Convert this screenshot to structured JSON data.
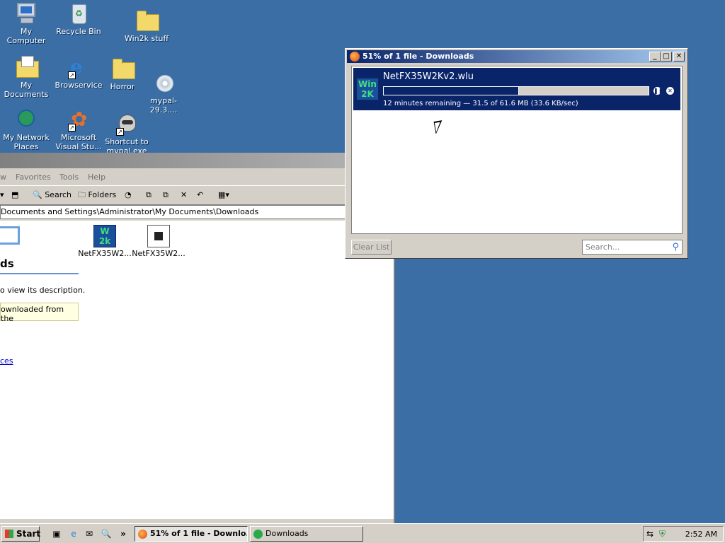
{
  "desktop": {
    "icons": [
      {
        "label": "My Computer"
      },
      {
        "label": "Recycle Bin"
      },
      {
        "label": "Win2k stuff"
      },
      {
        "label": "My Documents"
      },
      {
        "label": "Browservice"
      },
      {
        "label": "Horror"
      },
      {
        "label": "mypal-29.3...."
      },
      {
        "label": "My Network Places"
      },
      {
        "label": "Microsoft Visual Stu..."
      },
      {
        "label": "Shortcut to mypal.exe"
      }
    ]
  },
  "explorer": {
    "menu": [
      "w",
      "Favorites",
      "Tools",
      "Help"
    ],
    "toolbar": {
      "search_label": "Search",
      "folders_label": "Folders"
    },
    "address": "Documents and Settings\\Administrator\\My Documents\\Downloads",
    "heading": "ds",
    "hint": "o view its description.",
    "tip": "ownloaded from the",
    "link": "ces",
    "files": [
      {
        "label": "NetFX35W2..."
      },
      {
        "label": "NetFX35W2..."
      }
    ]
  },
  "downloads_window": {
    "title": "51% of 1 file - Downloads",
    "item": {
      "filename": "NetFX35W2Kv2.wlu",
      "progress_percent": 51,
      "status": "12 minutes remaining — 31.5 of 61.6 MB (33.6 KB/sec)",
      "thumb_text": "Win 2K"
    },
    "clear_list_label": "Clear List",
    "search_placeholder": "Search..."
  },
  "taskbar": {
    "start_label": "Start",
    "tasks": [
      {
        "label": "51% of 1 file - Downlo..."
      },
      {
        "label": "Downloads"
      }
    ],
    "clock": "2:52 AM",
    "chevron": "»"
  },
  "colors": {
    "desktop": "#3a6ea5",
    "selection": "#0a246a",
    "titlebar_start": "#0a246a",
    "titlebar_end": "#a6caf0"
  }
}
